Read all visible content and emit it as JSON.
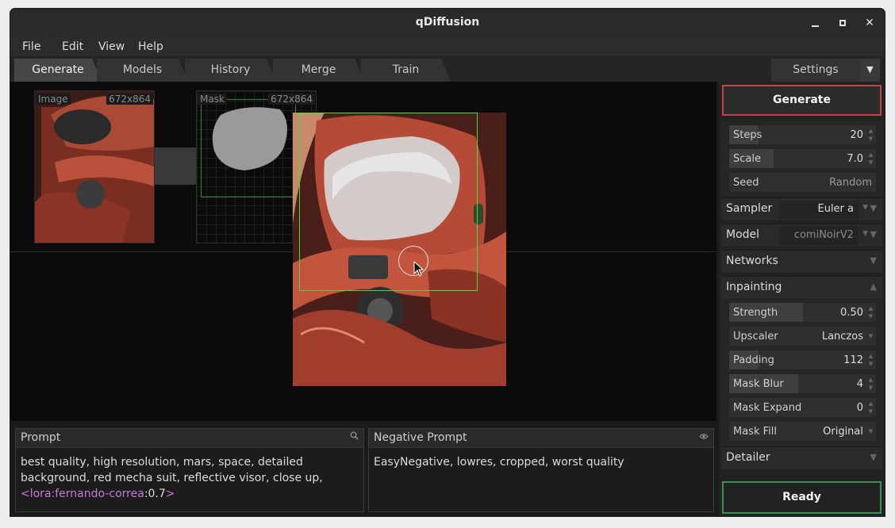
{
  "window": {
    "title": "qDiffusion"
  },
  "menu": [
    "File",
    "Edit",
    "View",
    "Help"
  ],
  "tabs": [
    "Generate",
    "Models",
    "History",
    "Merge",
    "Train"
  ],
  "active_tab": "Generate",
  "settings_tab": "Settings",
  "canvas": {
    "image_label": "Image",
    "image_size": "672x864",
    "mask_label": "Mask",
    "mask_size": "672x864"
  },
  "prompt": {
    "title": "Prompt",
    "text_plain": "best quality, high resolution, mars, space, detailed background, red mecha suit, reflective visor, close up, ",
    "lora_open": "<lora:",
    "lora_name": "fernando-correa",
    "lora_weight": ":0.7",
    "lora_close": ">"
  },
  "negative_prompt": {
    "title": "Negative Prompt",
    "text": "EasyNegative, lowres, cropped, worst quality"
  },
  "side": {
    "generate_label": "Generate",
    "params": {
      "steps": {
        "label": "Steps",
        "value": "20",
        "fill": 0.2
      },
      "scale": {
        "label": "Scale",
        "value": "7.0",
        "fill": 0.3
      },
      "seed": {
        "label": "Seed",
        "value": "Random"
      }
    },
    "sampler": {
      "label": "Sampler",
      "value": "Euler a"
    },
    "model": {
      "label": "Model",
      "value": "comiNoirV2"
    },
    "networks": {
      "label": "Networks"
    },
    "inpainting": {
      "label": "Inpainting",
      "strength": {
        "label": "Strength",
        "value": "0.50",
        "fill": 0.5
      },
      "upscaler": {
        "label": "Upscaler",
        "value": "Lanczos"
      },
      "padding": {
        "label": "Padding",
        "value": "112",
        "fill": 0.2
      },
      "mask_blur": {
        "label": "Mask Blur",
        "value": "4",
        "fill": 0.47
      },
      "mask_expand": {
        "label": "Mask Expand",
        "value": "0",
        "fill": 0
      },
      "mask_fill": {
        "label": "Mask Fill",
        "value": "Original"
      }
    },
    "detailer": {
      "label": "Detailer"
    },
    "status_label": "Ready"
  },
  "colors": {
    "generate_border": "#c34545",
    "ready_border": "#3d8f56",
    "selection_box": "#3ee03e",
    "lora_text": "#c77bd6"
  }
}
